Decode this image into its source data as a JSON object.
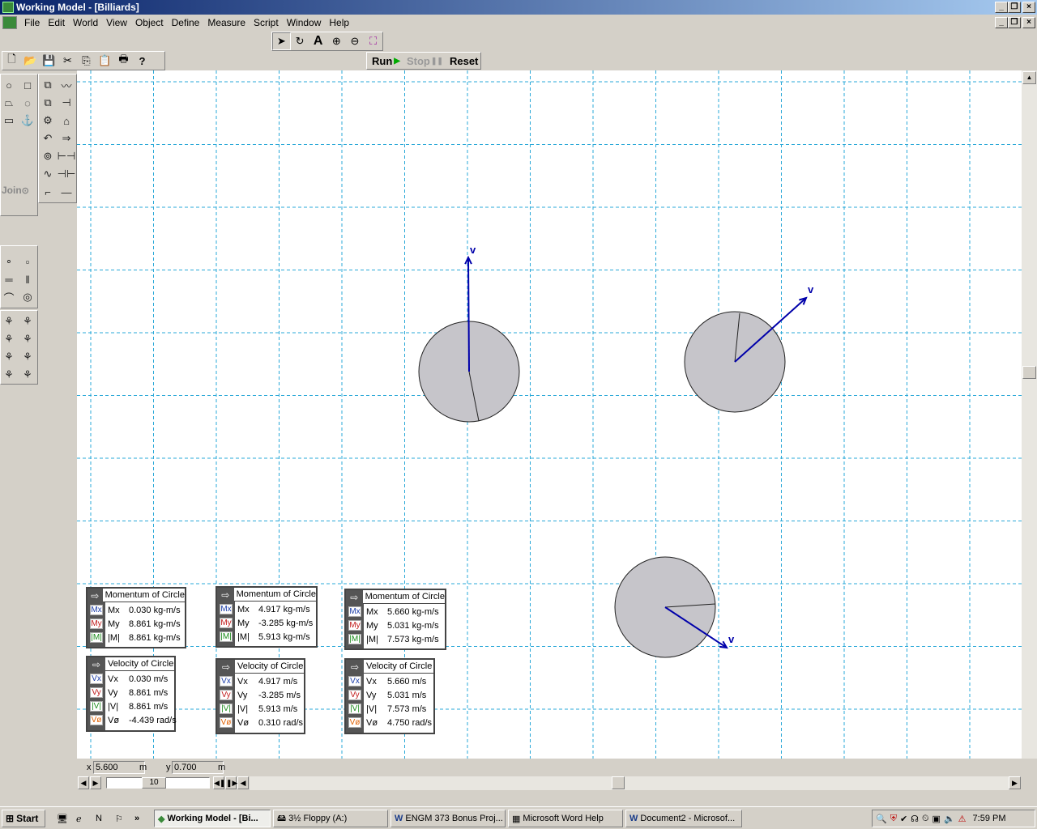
{
  "window": {
    "title": "Working Model - [Billiards]"
  },
  "menu": [
    "File",
    "Edit",
    "World",
    "View",
    "Object",
    "Define",
    "Measure",
    "Script",
    "Window",
    "Help"
  ],
  "run_controls": {
    "run": "Run",
    "stop": "Stop",
    "reset": "Reset"
  },
  "toolbox": {
    "join_label": "Join"
  },
  "vector_label": "v",
  "meters": [
    {
      "title": "Momentum of Circle",
      "rows": [
        {
          "chip": "Mx",
          "label": "Mx",
          "value": "0.030 kg-m/s"
        },
        {
          "chip": "My",
          "label": "My",
          "value": "8.861 kg-m/s"
        },
        {
          "chip": "|M|",
          "label": "|M|",
          "value": "8.861 kg-m/s"
        }
      ]
    },
    {
      "title": "Momentum of Circle",
      "rows": [
        {
          "chip": "Mx",
          "label": "Mx",
          "value": "4.917 kg-m/s"
        },
        {
          "chip": "My",
          "label": "My",
          "value": "-3.285 kg-m/s"
        },
        {
          "chip": "|M|",
          "label": "|M|",
          "value": "5.913 kg-m/s"
        }
      ]
    },
    {
      "title": "Momentum of Circle",
      "rows": [
        {
          "chip": "Mx",
          "label": "Mx",
          "value": "5.660 kg-m/s"
        },
        {
          "chip": "My",
          "label": "My",
          "value": "5.031 kg-m/s"
        },
        {
          "chip": "|M|",
          "label": "|M|",
          "value": "7.573 kg-m/s"
        }
      ]
    },
    {
      "title": "Velocity of Circle",
      "rows": [
        {
          "chip": "Vx",
          "label": "Vx",
          "value": "0.030 m/s"
        },
        {
          "chip": "Vy",
          "label": "Vy",
          "value": "8.861 m/s"
        },
        {
          "chip": "|V|",
          "label": "|V|",
          "value": "8.861 m/s"
        },
        {
          "chip": "Vø",
          "label": "Vø",
          "value": "-4.439 rad/s"
        }
      ]
    },
    {
      "title": "Velocity of Circle",
      "rows": [
        {
          "chip": "Vx",
          "label": "Vx",
          "value": "4.917 m/s"
        },
        {
          "chip": "Vy",
          "label": "Vy",
          "value": "-3.285 m/s"
        },
        {
          "chip": "|V|",
          "label": "|V|",
          "value": "5.913 m/s"
        },
        {
          "chip": "Vø",
          "label": "Vø",
          "value": "0.310 rad/s"
        }
      ]
    },
    {
      "title": "Velocity of Circle",
      "rows": [
        {
          "chip": "Vx",
          "label": "Vx",
          "value": "5.660 m/s"
        },
        {
          "chip": "Vy",
          "label": "Vy",
          "value": "5.031 m/s"
        },
        {
          "chip": "|V|",
          "label": "|V|",
          "value": "7.573 m/s"
        },
        {
          "chip": "Vø",
          "label": "Vø",
          "value": "4.750 rad/s"
        }
      ]
    }
  ],
  "status": {
    "x_label": "x",
    "x_value": "5.600",
    "x_unit": "m",
    "y_label": "y",
    "y_value": "0.700",
    "y_unit": "m"
  },
  "playback": {
    "frame": "10"
  },
  "taskbar": {
    "start": "Start",
    "tasks": [
      "Working Model - [Bi...",
      "3½ Floppy (A:)",
      "ENGM 373 Bonus Proj...",
      "Microsoft Word Help",
      "Document2 - Microsof..."
    ],
    "clock": "7:59 PM"
  },
  "colors": {
    "vector": "#0000aa",
    "grid": "#2aa8d8",
    "body": "#c6c5ca",
    "titlebar": "#0a246a"
  }
}
